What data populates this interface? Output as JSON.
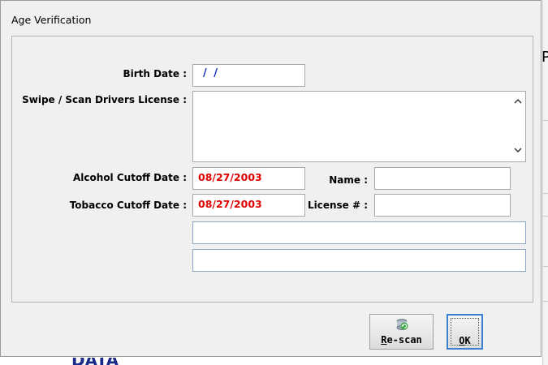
{
  "dialog": {
    "title": "Age Verification"
  },
  "form": {
    "birth_date_label": "Birth Date :",
    "birth_date_value": "/ /",
    "swipe_label": "Swipe / Scan Drivers License :",
    "swipe_value": "",
    "alcohol_label": "Alcohol Cutoff Date :",
    "alcohol_value": "08/27/2003",
    "tobacco_label": "Tobacco Cutoff Date :",
    "tobacco_value": "08/27/2003",
    "name_label": "Name :",
    "name_value": "",
    "license_label": "License # :",
    "license_value": "",
    "extra1_value": "",
    "extra2_value": ""
  },
  "buttons": {
    "rescan_first": "R",
    "rescan_rest": "e-scan",
    "ok_first": "O",
    "ok_rest": "K"
  },
  "icons": {
    "scroll_up": "chevron-up-icon",
    "scroll_down": "chevron-down-icon",
    "rescan": "refresh-icon"
  },
  "background": {
    "right_fragment": "P",
    "bottom_fragment": "DATA"
  },
  "colors": {
    "cutoff_text": "#e00000",
    "birth_text": "#1030c0",
    "ok_focus": "#3c7fd0"
  }
}
